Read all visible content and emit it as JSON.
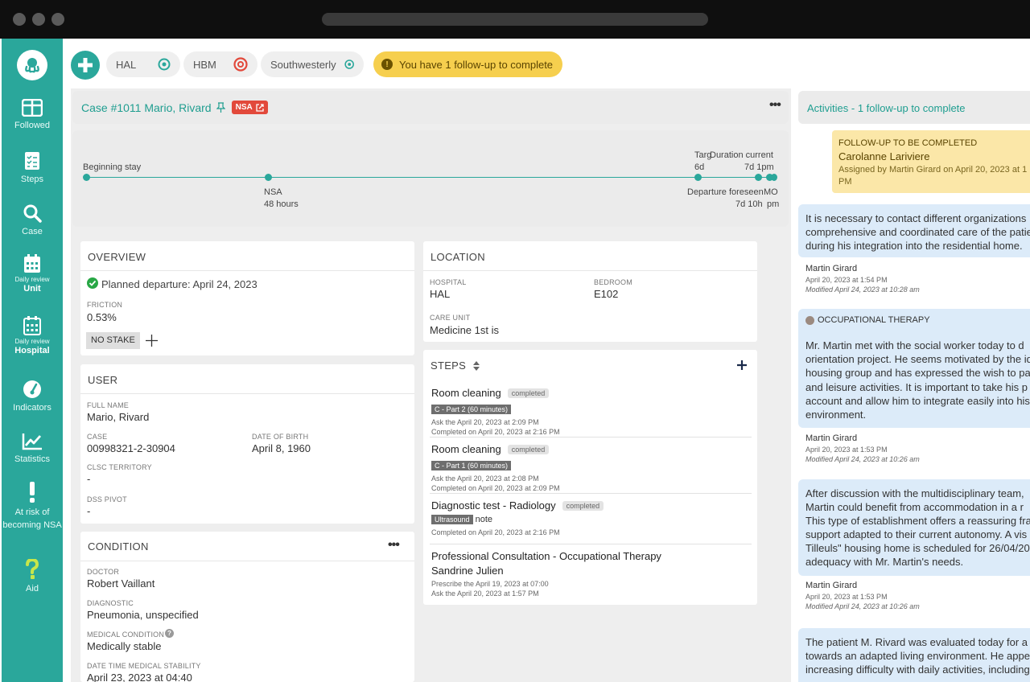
{
  "topbar": {
    "pills": [
      {
        "label": "HAL",
        "status_color": "#2aa79b"
      },
      {
        "label": "HBM",
        "status_color": "#e2493b"
      },
      {
        "label": "Southwesterly",
        "status_color": "#2aa79b"
      }
    ],
    "followup_alert": "You have 1 follow-up to complete"
  },
  "sidebar": {
    "items": [
      {
        "label": "Followed",
        "icon": "columns-icon"
      },
      {
        "label": "Steps",
        "icon": "checklist-icon"
      },
      {
        "label": "Case",
        "icon": "search-icon"
      },
      {
        "sub": "Daily review",
        "label": "Unit",
        "icon": "calendar-icon"
      },
      {
        "sub": "Daily review",
        "label": "Hospital",
        "icon": "calendar-grid-icon"
      },
      {
        "label": "Indicators",
        "icon": "gauge-icon"
      },
      {
        "label": "Statistics",
        "icon": "chart-icon"
      },
      {
        "label": "At risk of becoming NSA",
        "icon": "exclamation-icon"
      },
      {
        "label": "Aid",
        "icon": "question-icon"
      }
    ]
  },
  "case": {
    "title": "Case #1011  Mario, Rivard",
    "badge": "NSA"
  },
  "timeline": {
    "beginning": "Beginning stay",
    "nsa": "NSA",
    "nsa_hours": "48 hours",
    "target_label": "Targ",
    "target_value": "6d ",
    "duration_label": "Duration current",
    "duration_value": "7d 1pm",
    "departure_label": "Departure foreseen",
    "departure_value": "7d 10h",
    "mo_label": "MO",
    "mo_value": "pm"
  },
  "overview": {
    "heading": "OVERVIEW",
    "planned": "Planned departure: April 24, 2023",
    "friction_label": "FRICTION",
    "friction_value": "0.53%",
    "stake": "NO STAKE"
  },
  "user": {
    "heading": "USER",
    "fullname_label": "FULL NAME",
    "fullname": "Mario, Rivard",
    "case_label": "CASE",
    "case_value": "00998321-2-30904",
    "dob_label": "DATE OF BIRTH",
    "dob": "April 8, 1960",
    "clsc_label": "CLSC TERRITORY",
    "clsc_value": "-",
    "dss_label": "DSS PIVOT",
    "dss_value": "-"
  },
  "condition": {
    "heading": "CONDITION",
    "doctor_label": "DOCTOR",
    "doctor": "Robert Vaillant",
    "diag_label": "DIAGNOSTIC",
    "diag": "Pneumonia, unspecified",
    "medcond_label": "MEDICAL CONDITION",
    "medcond": "Medically stable",
    "stability_label": "DATE TIME MEDICAL STABILITY",
    "stability": "April 23, 2023 at 04:40"
  },
  "location": {
    "heading": "LOCATION",
    "hospital_label": "HOSPITAL",
    "hospital": "HAL",
    "bedroom_label": "BEDROOM",
    "bedroom": "E102",
    "unit_label": "CARE UNIT",
    "unit": "Medicine 1st is"
  },
  "steps": {
    "heading": "STEPS",
    "items": [
      {
        "title": "Room cleaning",
        "status": "completed",
        "tag": "C - Part 2 (60 minutes)",
        "line1": "Ask the April 20, 2023 at 2:09 PM",
        "line2": "Completed on April 20, 2023 at 2:16 PM"
      },
      {
        "title": "Room cleaning",
        "status": "completed",
        "tag": "C - Part 1 (60 minutes)",
        "line1": "Ask the April 20, 2023 at 2:08 PM",
        "line2": "Completed on April 20, 2023 at 2:09 PM"
      },
      {
        "title": "Diagnostic test  -  Radiology",
        "status": "completed",
        "tag": "Ultrasound",
        "tag_note": "note",
        "line2": "Completed on April 20, 2023 at 2:16 PM"
      },
      {
        "title": "Professional Consultation  -  Occupational Therapy",
        "person": "Sandrine Julien",
        "line1": "Prescribe the April 19, 2023 at 07:00",
        "line2": "Ask the April 20, 2023 at 1:57 PM"
      }
    ]
  },
  "activities": {
    "title": "Activities - 1 follow-up to complete",
    "followup": {
      "heading": "FOLLOW-UP TO BE COMPLETED",
      "person": "Carolanne Lariviere",
      "assigned_line1": "Assigned by Martin Girard on April 20, 2023 at 1",
      "assigned_line2": "PM"
    },
    "notes": [
      {
        "lines": [
          "It is necessary to contact different organizations",
          "comprehensive and coordinated care of the patie",
          "during his integration into the residential home."
        ],
        "author": "Martin Girard",
        "date": "April 20, 2023 at 1:54 PM",
        "modified": "Modified  April 24, 2023 at 10:28 am"
      },
      {
        "category": "OCCUPATIONAL THERAPY",
        "lines": [
          "Mr. Martin met with the social worker today to d",
          "orientation project. He seems motivated by the id",
          "housing group and has expressed the wish to pa",
          "and leisure activities. It is important to take his p",
          "account and allow him to integrate easily into his",
          "environment."
        ],
        "author": "Martin Girard",
        "date": "April 20, 2023 at 1:53 PM",
        "modified": "Modified  April 24, 2023 at 10:26 am"
      },
      {
        "lines": [
          "After discussion with the multidisciplinary team,",
          "Martin could benefit from accommodation in a r",
          "This type of establishment offers a reassuring fra",
          "support adapted to their current autonomy. A vis",
          "Tilleuls\" housing home is scheduled for 26/04/20",
          "adequacy with Mr. Martin's needs."
        ],
        "author": "Martin Girard",
        "date": "April 20, 2023 at 1:53 PM",
        "modified": "Modified  April 24, 2023 at 10:26 am"
      },
      {
        "lines": [
          "The patient M. Rivard was evaluated today for a r",
          "towards an adapted living environment. He appe",
          "increasing difficulty with daily activities, including"
        ]
      }
    ]
  },
  "colors": {
    "accent": "#2aa79b",
    "alert": "#f6cf4e",
    "nsa": "#e2493b",
    "note": "#dcebf9"
  }
}
